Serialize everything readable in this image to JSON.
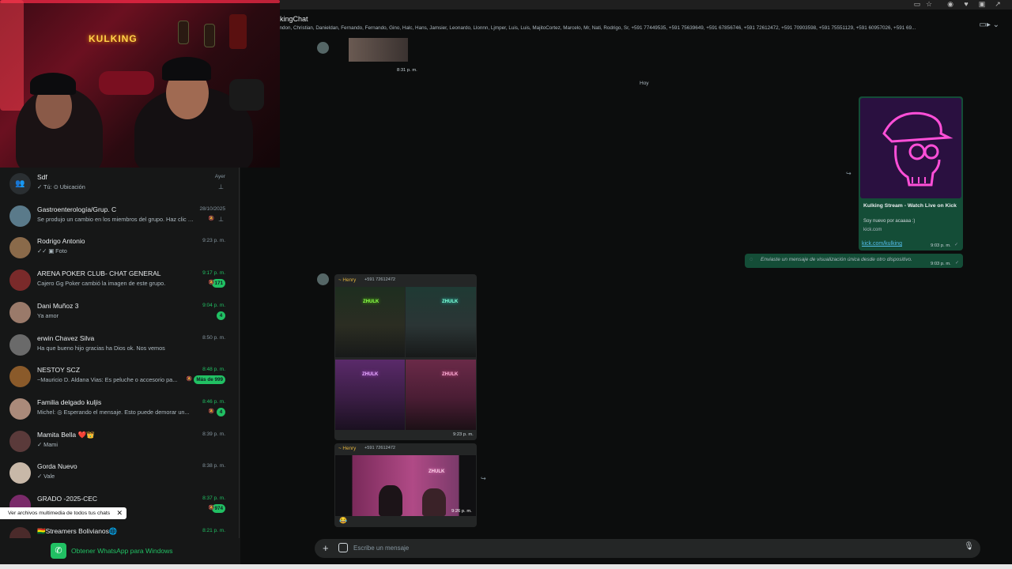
{
  "header": {
    "title": "kingChat",
    "members": "endon, Christian, Danieldan, Fernando, Fernando, Gino, Halc, Hans, Jamsier, Leonardo, Llonnn, Ljmper, Luis, Luis, MajitoCortez, Marcelo, Mr, Nati, Rodrigo, Sr, +591 77449535, +591 75639649, +591 67856746, +591 72612472, +591 70903598, +591 75551129, +591 60957026, +591 69..."
  },
  "webcam": {
    "neon_sign": "KULKING"
  },
  "sidebar": {
    "chats": [
      {
        "name": "Sdf",
        "preview": "✓ Tú: ⊙ Ubicación",
        "time": "Ayer",
        "time_green": false,
        "badge": "",
        "muted": false,
        "pinned": true
      },
      {
        "name": "Gastroenterología/Grup. C",
        "preview": "Se produjo un cambio en los miembros del grupo. Haz clic pa...",
        "time": "28/10/2025",
        "time_green": false,
        "badge": "",
        "muted": true,
        "pinned": true
      },
      {
        "name": "Rodrigo Antonio",
        "preview": "✓✓ ▣ Foto",
        "time": "9:23 p. m.",
        "time_green": false,
        "badge": "",
        "muted": false,
        "pinned": false
      },
      {
        "name": "ARENA POKER CLUB- CHAT GENERAL",
        "preview": "Cajero Gg Poker cambió la imagen de este grupo.",
        "time": "9:17 p. m.",
        "time_green": true,
        "badge": "171",
        "muted": true,
        "pinned": false
      },
      {
        "name": "Dani Muñoz 3",
        "preview": "Ya amor",
        "time": "9:04 p. m.",
        "time_green": true,
        "badge": "4",
        "muted": false,
        "pinned": false
      },
      {
        "name": "erwin Chavez Silva",
        "preview": "Ha que bueno hijo gracias ha Dios ok. Nos vemos",
        "time": "8:50 p. m.",
        "time_green": false,
        "badge": "",
        "muted": false,
        "pinned": false
      },
      {
        "name": "NESTOY SCZ",
        "preview": "~Mauricio D. Aldana Vias: Es peluche o accesorio pa...",
        "time": "8:48 p. m.",
        "time_green": true,
        "badge": "Más de 999",
        "muted": true,
        "pinned": false
      },
      {
        "name": "Familia delgado kuljis",
        "preview": "Michel: ◎ Esperando el mensaje. Esto puede demorar un...",
        "time": "8:46 p. m.",
        "time_green": true,
        "badge": "4",
        "muted": true,
        "pinned": false
      },
      {
        "name": "Mamita Bella ❤️👑",
        "preview": "✓ Mami",
        "time": "8:39 p. m.",
        "time_green": false,
        "badge": "",
        "muted": false,
        "pinned": false
      },
      {
        "name": "Gorda Nuevo",
        "preview": "✓ Vale",
        "time": "8:38 p. m.",
        "time_green": false,
        "badge": "",
        "muted": false,
        "pinned": false
      },
      {
        "name": "GRADO -2025-CEC",
        "preview": "",
        "time": "8:37 p. m.",
        "time_green": true,
        "badge": "974",
        "muted": true,
        "pinned": false
      },
      {
        "name": "🇧🇴Streamers Bolivianos🌐",
        "preview": "",
        "time": "8:21 p. m.",
        "time_green": true,
        "badge": "",
        "muted": false,
        "pinned": false
      }
    ],
    "tooltip": "Ver archivos multimedia de todos tus chats",
    "get_app": "Obtener WhatsApp para Windows"
  },
  "messages": {
    "top_image_time": "8:31 p. m.",
    "date_separator": "Hoy",
    "link_card": {
      "title": "Kulking Stream - Watch Live on Kick",
      "description": "Soy nuevo por acaaaa :)",
      "domain": "kick.com",
      "link": "kick.com/kulking",
      "time": "9:03 p. m."
    },
    "view_once": {
      "text": "Enviaste un mensaje de visualización única desde otro dispositivo.",
      "time": "9:03 p. m."
    },
    "grid_message": {
      "sender": "~ Henry",
      "phone": "+591 72612472",
      "time": "9:23 p. m.",
      "thumb_label": "ZHULK"
    },
    "single_image": {
      "sender": "~ Henry",
      "phone": "+591 72612472",
      "time": "9:26 p. m.",
      "reaction": "😂"
    }
  },
  "composer": {
    "placeholder": "Escribe un mensaje"
  },
  "colors": {
    "accent": "#21c063",
    "sender_henry": "#e2b33e",
    "outgoing_bubble": "#144d37"
  }
}
